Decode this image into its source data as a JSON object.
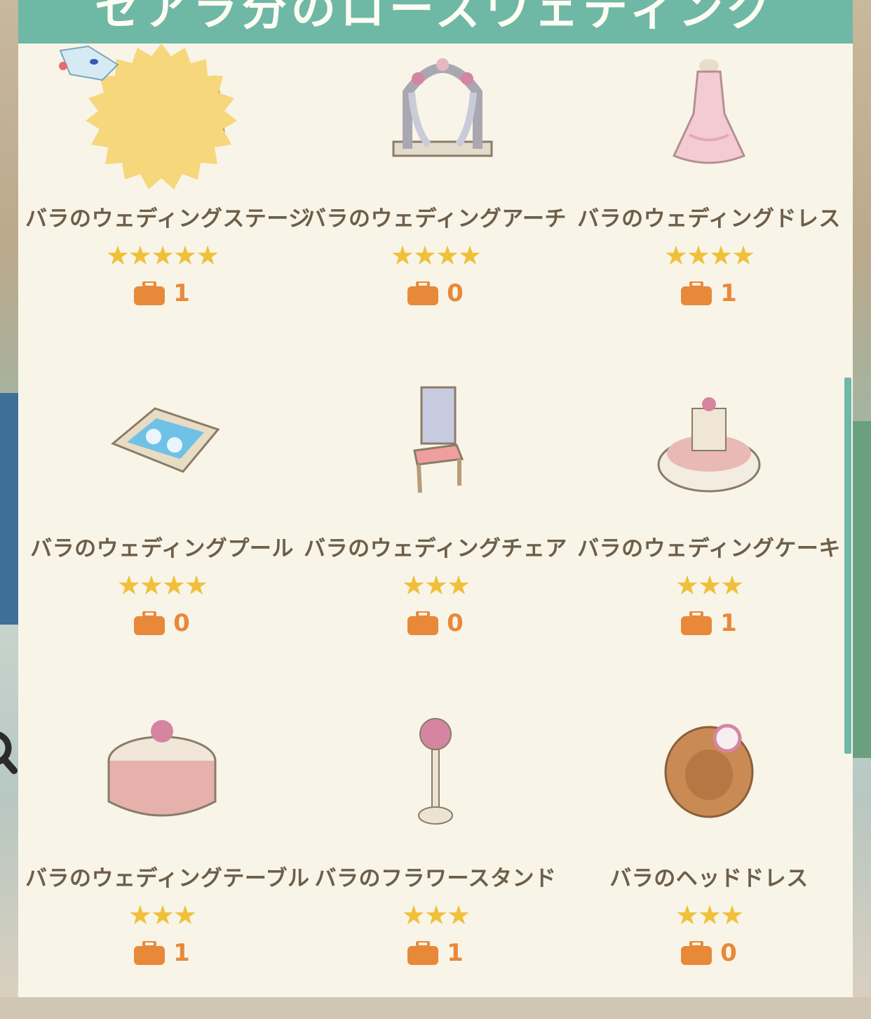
{
  "header": {
    "title": "セアラ分のローズウェディング"
  },
  "colors": {
    "accent": "#6fb8a6",
    "star": "#f1c03a",
    "bag": "#e8893a",
    "text": "#6e5e49",
    "panel": "#f8f5e8"
  },
  "items": [
    {
      "name": "バラのウェディングステージ",
      "stars": "★★★★★",
      "star_count": 5,
      "count": "1",
      "icon": "wedding-stage-icon"
    },
    {
      "name": "バラのウェディングアーチ",
      "stars": "★★★★",
      "star_count": 4,
      "count": "0",
      "icon": "wedding-arch-icon"
    },
    {
      "name": "バラのウェディングドレス",
      "stars": "★★★★",
      "star_count": 4,
      "count": "1",
      "icon": "wedding-dress-icon"
    },
    {
      "name": "バラのウェディングプール",
      "stars": "★★★★",
      "star_count": 4,
      "count": "0",
      "icon": "wedding-pool-icon"
    },
    {
      "name": "バラのウェディングチェア",
      "stars": "★★★",
      "star_count": 3,
      "count": "0",
      "icon": "wedding-chair-icon"
    },
    {
      "name": "バラのウェディングケーキ",
      "stars": "★★★",
      "star_count": 3,
      "count": "1",
      "icon": "wedding-cake-icon"
    },
    {
      "name": "バラのウェディングテーブル",
      "stars": "★★★",
      "star_count": 3,
      "count": "1",
      "icon": "wedding-table-icon"
    },
    {
      "name": "バラのフラワースタンド",
      "stars": "★★★",
      "star_count": 3,
      "count": "1",
      "icon": "flower-stand-icon"
    },
    {
      "name": "バラのヘッドドレス",
      "stars": "★★★",
      "star_count": 3,
      "count": "0",
      "icon": "headdress-icon"
    }
  ]
}
